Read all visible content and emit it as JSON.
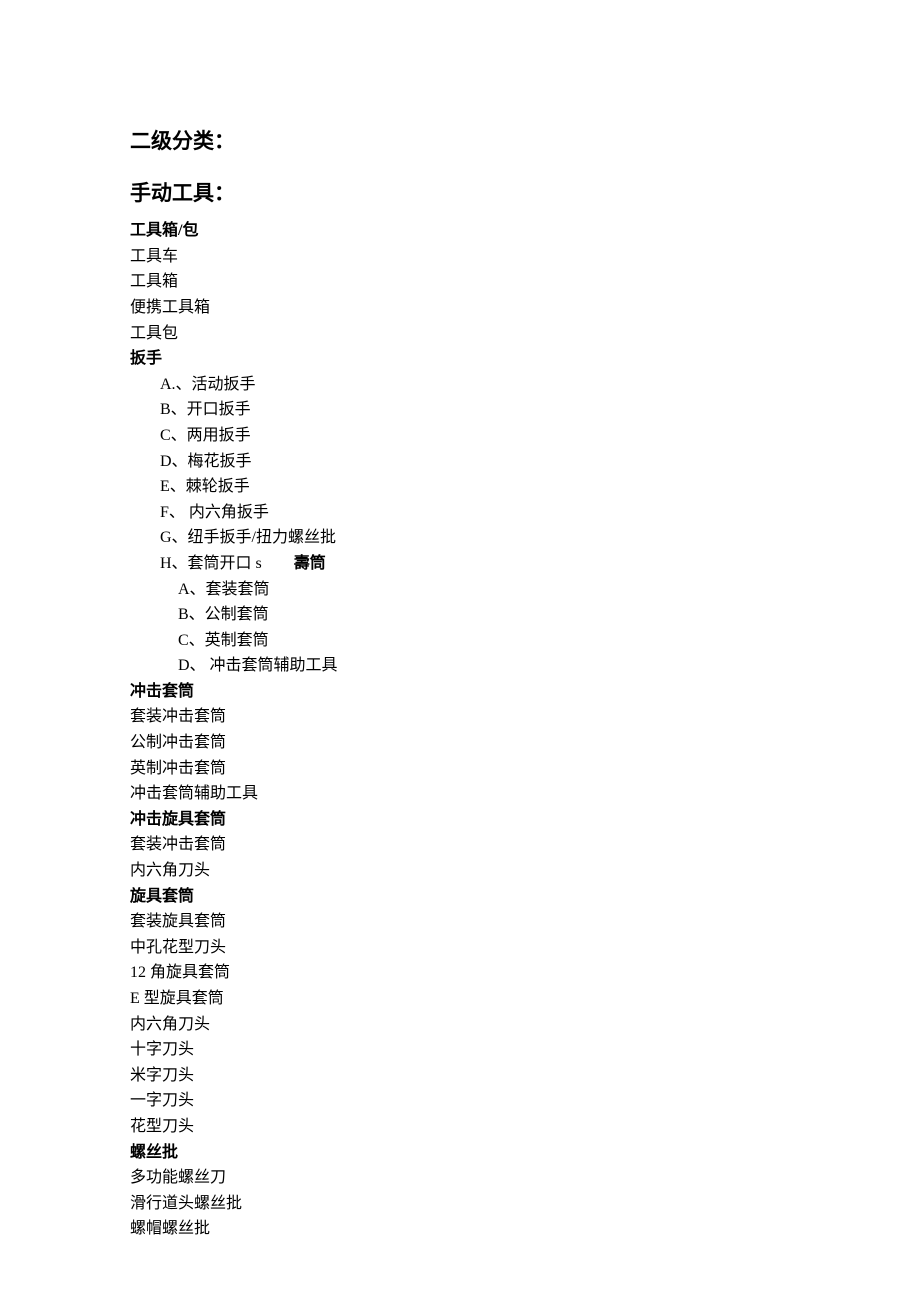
{
  "heading_main": "二级分类：",
  "heading_section": "手动工具：",
  "cat_toolbox_label": "工具箱/包",
  "toolbox_items": [
    "工具车",
    "工具箱",
    "便携工具箱",
    "工具包"
  ],
  "cat_wrench_label": "扳手",
  "wrench_lines": [
    "A.、活动扳手",
    "B、开口扳手",
    "C、两用扳手",
    "D、梅花扳手",
    "E、棘轮扳手",
    "F、 内六角扳手",
    "G、纽手扳手/扭力螺丝批"
  ],
  "wrench_h_prefix": "H、套筒开口 s",
  "wrench_h_bold": "壽筒",
  "socket_sub": [
    "A、套装套筒",
    "B、公制套筒",
    "C、英制套筒",
    "D、 冲击套筒辅助工具"
  ],
  "cat_impact_label": "冲击套筒",
  "impact_items": [
    "套装冲击套筒",
    "公制冲击套筒",
    "英制冲击套筒",
    "冲击套筒辅助工具"
  ],
  "cat_impact_spin_label": "冲击旋具套筒",
  "impact_spin_items": [
    "套装冲击套筒",
    "内六角刀头"
  ],
  "cat_spin_label": "旋具套筒",
  "spin_items": [
    "套装旋具套筒",
    "中孔花型刀头",
    "12 角旋具套筒",
    "E 型旋具套筒",
    "内六角刀头",
    "十字刀头",
    "米字刀头",
    "一字刀头",
    "花型刀头"
  ],
  "cat_screw_label": "螺丝批",
  "screw_items": [
    "多功能螺丝刀",
    "滑行道头螺丝批",
    "螺帽螺丝批"
  ]
}
